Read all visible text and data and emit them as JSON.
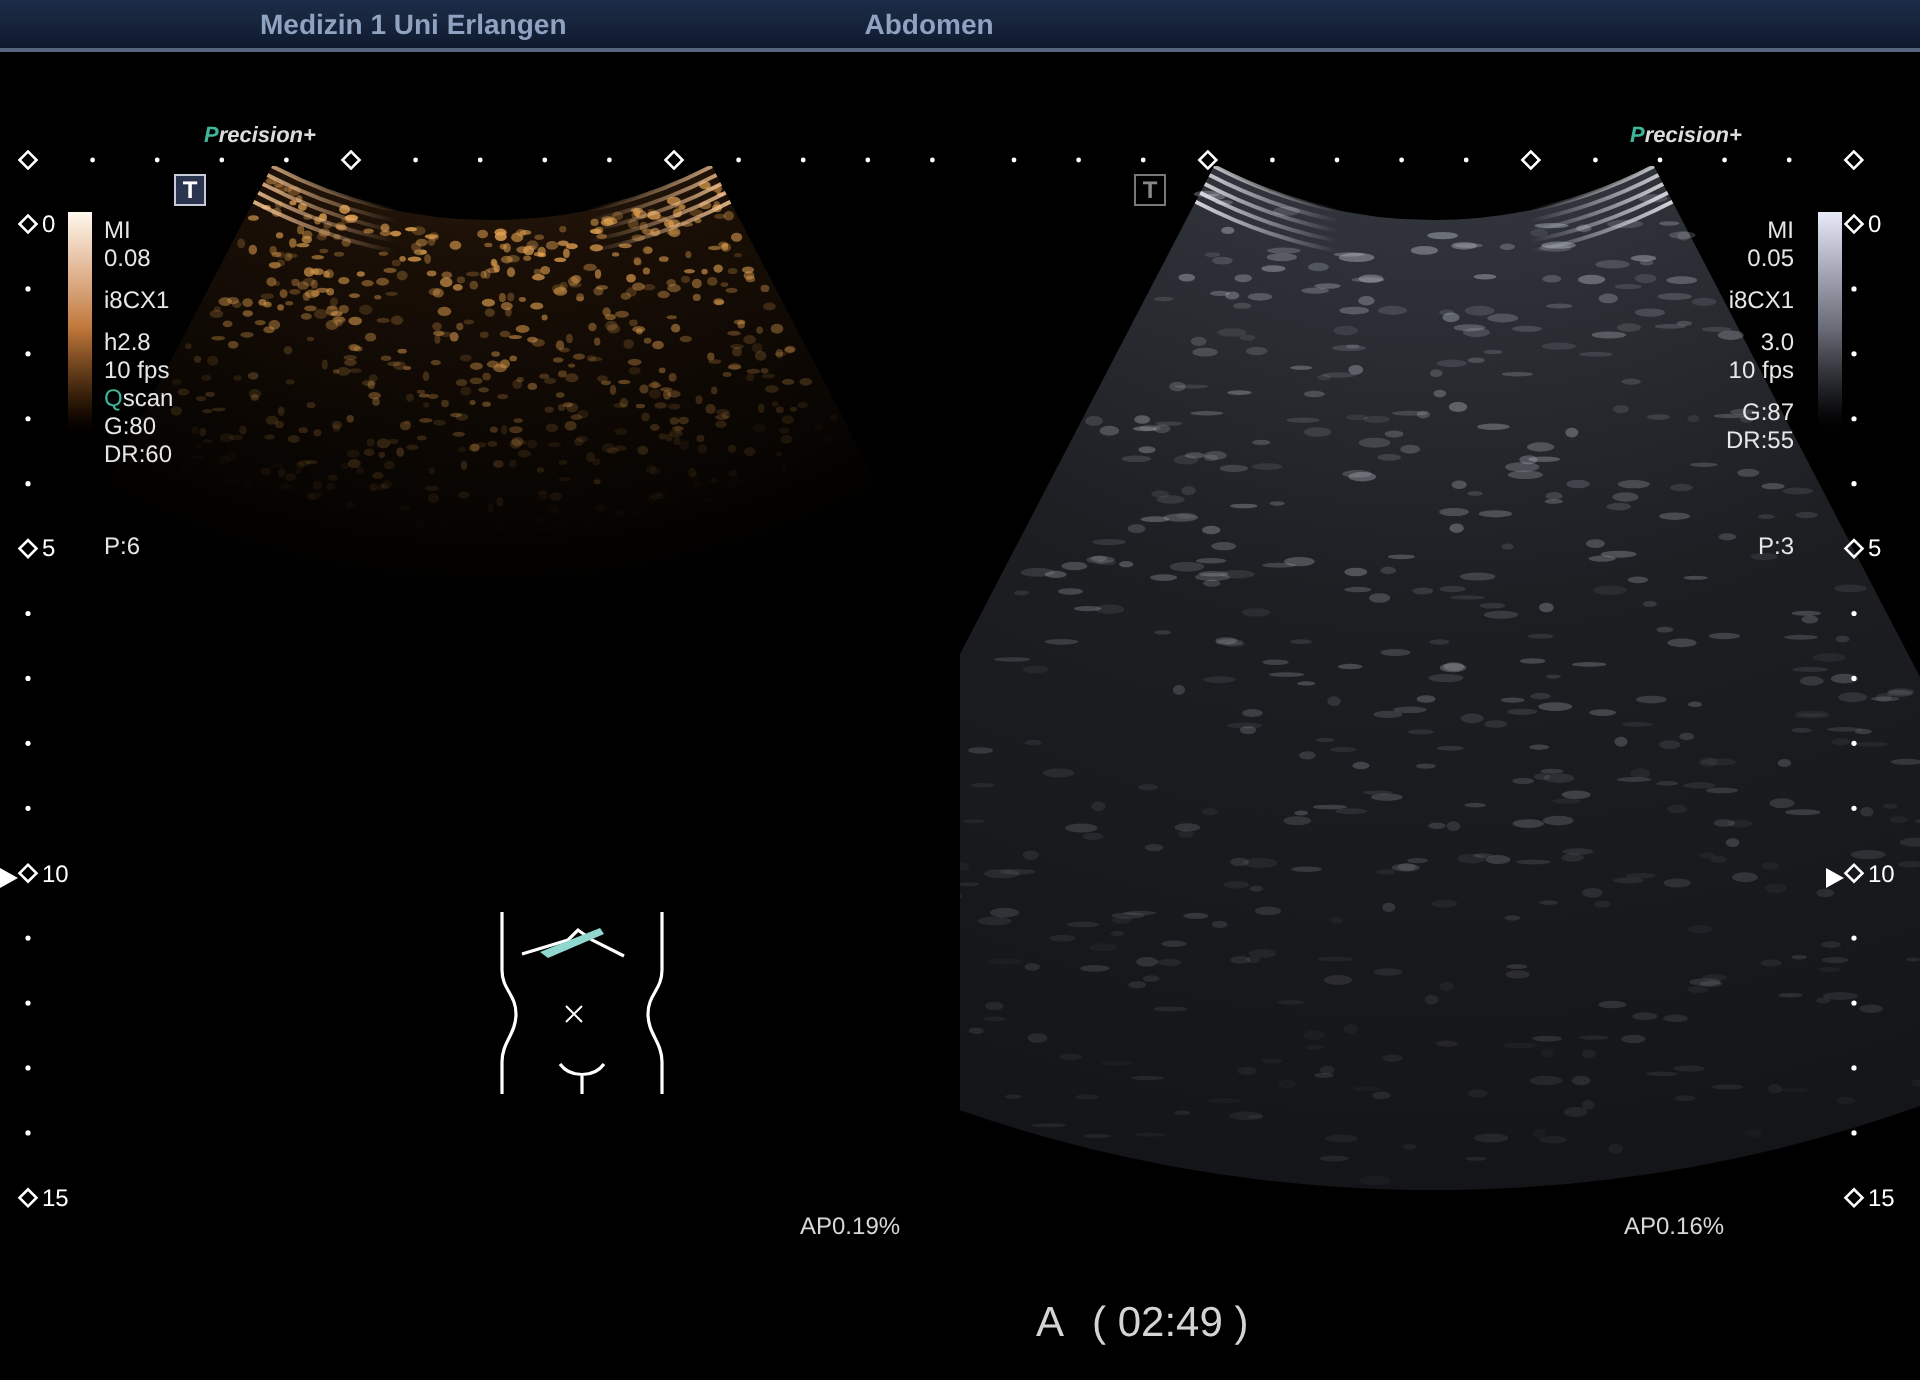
{
  "header": {
    "institution": "Medizin 1 Uni Erlangen",
    "exam": "Abdomen"
  },
  "panes": [
    {
      "kind": "contrast",
      "logo": "Precision+",
      "orientation_mark": {
        "text": "T",
        "active": true
      },
      "parameters": [
        [
          {
            "text": "MI",
            "kind": "plain"
          },
          {
            "text": "0.08",
            "kind": "plain"
          }
        ],
        [
          {
            "text": "i8CX1",
            "kind": "plain"
          }
        ],
        [
          {
            "text": "h2.8",
            "kind": "plain"
          },
          {
            "text": "10 fps",
            "kind": "plain"
          },
          {
            "text": "Qscan",
            "kind": "mode"
          },
          {
            "text": "G:80",
            "kind": "plain"
          },
          {
            "text": "DR:60",
            "kind": "plain"
          }
        ]
      ],
      "persistence": "P:6",
      "depth_scale": [
        {
          "label": "0",
          "focus": false
        },
        {
          "label": "5",
          "focus": false
        },
        {
          "label": "10",
          "focus": true
        },
        {
          "label": "15",
          "focus": false
        }
      ],
      "acoustic_power": "AP0.19%",
      "body_marker": true
    },
    {
      "kind": "bmode",
      "logo": "Precision+",
      "orientation_mark": {
        "text": "T",
        "active": false
      },
      "parameters": [
        [
          {
            "text": "MI",
            "kind": "plain"
          },
          {
            "text": "0.05",
            "kind": "plain"
          }
        ],
        [
          {
            "text": "i8CX1",
            "kind": "plain"
          }
        ],
        [
          {
            "text": "3.0",
            "kind": "plain"
          },
          {
            "text": "10 fps",
            "kind": "plain"
          }
        ],
        [
          {
            "text": "G:87",
            "kind": "plain"
          },
          {
            "text": "DR:55",
            "kind": "plain"
          }
        ]
      ],
      "persistence": "P:3",
      "depth_scale": [
        {
          "label": "0",
          "focus": false
        },
        {
          "label": "5",
          "focus": false
        },
        {
          "label": "10",
          "focus": true
        },
        {
          "label": "15",
          "focus": false
        }
      ],
      "acoustic_power": "AP0.16%"
    }
  ],
  "clip_timer": {
    "label": "A",
    "time": "( 02:49 )"
  }
}
